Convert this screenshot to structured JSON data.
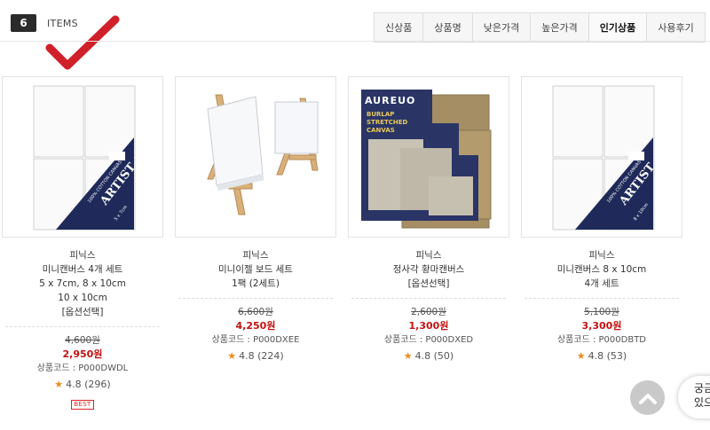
{
  "header": {
    "count": "6",
    "items_label": "ITEMS",
    "sort_tabs": [
      "신상품",
      "상품명",
      "낮은가격",
      "높은가격",
      "인기상품",
      "사용후기"
    ],
    "active_tab": "인기상품"
  },
  "products": [
    {
      "name_lines": [
        "피닉스",
        "미니캔버스 4개 세트",
        "5 x 7cm, 8 x 10cm",
        "10 x 10cm",
        "[옵션선택]"
      ],
      "original_price": "4,600원",
      "sale_price": "2,950원",
      "code": "상품코드 : P000DWDL",
      "rating": "4.8 (296)",
      "badge": "BEST",
      "image_text": [
        "ARTIST",
        "100% COTTON CANVAS",
        "5 x 7cm"
      ]
    },
    {
      "name_lines": [
        "피닉스",
        "미니이젤 보드 세트",
        "1팩 (2세트)"
      ],
      "original_price": "6,600원",
      "sale_price": "4,250원",
      "code": "상품코드 : P000DXEE",
      "rating": "4.8 (224)",
      "badge": ""
    },
    {
      "name_lines": [
        "피닉스",
        "정사각 황마캔버스",
        "[옵션선택]"
      ],
      "original_price": "2,600원",
      "sale_price": "1,300원",
      "code": "상품코드 : P000DXED",
      "rating": "4.8 (50)",
      "badge": "",
      "image_text": [
        "AUREUO",
        "BURLAP",
        "STRETCHED",
        "CANVAS"
      ]
    },
    {
      "name_lines": [
        "피닉스",
        "미니캔버스 8 x 10cm",
        "4개 세트"
      ],
      "original_price": "5,100원",
      "sale_price": "3,300원",
      "code": "상품코드 : P000DBTD",
      "rating": "4.8 (53)",
      "badge": "",
      "image_text": [
        "ARTIST",
        "100% COTTON CANVAS",
        "8 x 10cm"
      ]
    }
  ],
  "floating": {
    "chat_text": [
      "궁금",
      "있으"
    ],
    "scroll_top_icon": "chevron-up-icon"
  },
  "colors": {
    "sale_price": "#c31111",
    "star": "#f08a1c",
    "badge": "#2b2b2b",
    "checkmark": "#d0202a"
  }
}
